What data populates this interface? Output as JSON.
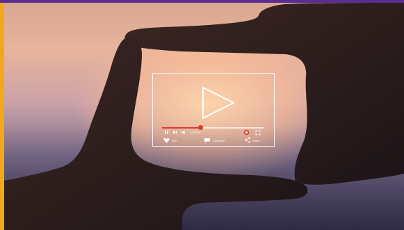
{
  "colors": {
    "top_bar": "#5b2d91",
    "left_bar": "#f3a81b",
    "progress_accent": "#e03a2e"
  },
  "player": {
    "progress": 0.38,
    "time": "1:03/2:56",
    "like_label": "Like",
    "comment_label": "Comment",
    "share_label": "Share",
    "icons": [
      "play-icon",
      "pause-icon",
      "skip-next-icon",
      "volume-icon",
      "settings-icon",
      "fullscreen-icon",
      "heart-icon",
      "comment-icon",
      "share-icon"
    ]
  }
}
